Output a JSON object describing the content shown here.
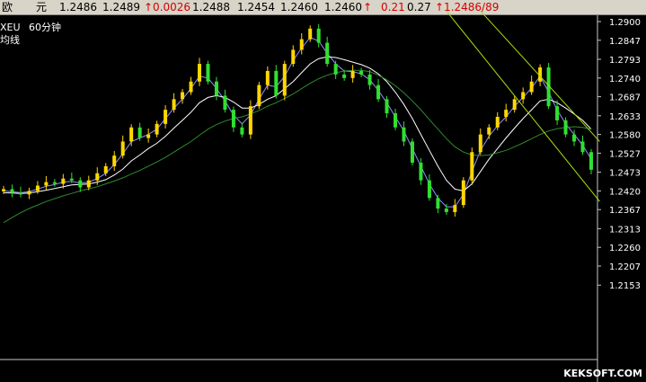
{
  "quote": {
    "name1": "欧",
    "name2": "元",
    "v1": "1.2486",
    "v2": "1.2489",
    "change": "↑0.0026",
    "v3": "1.2488",
    "v4": "1.2454",
    "v5": "1.2460",
    "v6": "1.2460",
    "arrow": "↑",
    "v7": "0.21",
    "v8": "0.27",
    "last": "↑1.2486/89"
  },
  "symbol_label": "XEU",
  "period_label": "60分钟",
  "ma_label": "均线",
  "watermark": "KEKSOFT.COM",
  "colors": {
    "background": "#000000",
    "bull_candle": "#ffd700",
    "bear_candle": "#30e030",
    "ma_short": "#9090ff",
    "ma_mid": "#ffffff",
    "ma_long": "#2e8b2e",
    "trend_line": "#a8e010",
    "axis": "#c8c8c8"
  },
  "chart_data": {
    "type": "candlestick",
    "y_axis": {
      "range": [
        1.208,
        1.293
      ],
      "tick_labels": [
        "1.2900",
        "1.2847",
        "1.2793",
        "1.2740",
        "1.2687",
        "1.2633",
        "1.2580",
        "1.2527",
        "1.2473",
        "1.2420",
        "1.2367",
        "1.2313",
        "1.2260",
        "1.2207",
        "1.2153"
      ],
      "tick_values": [
        1.29,
        1.2847,
        1.2793,
        1.274,
        1.2687,
        1.2633,
        1.258,
        1.2527,
        1.2473,
        1.242,
        1.2367,
        1.2313,
        1.226,
        1.2207,
        1.2153
      ]
    },
    "approximate_close_path": [
      1.2425,
      1.2415,
      1.241,
      1.242,
      1.2435,
      1.2445,
      1.244,
      1.2455,
      1.245,
      1.243,
      1.245,
      1.247,
      1.249,
      1.252,
      1.256,
      1.26,
      1.257,
      1.258,
      1.261,
      1.265,
      1.268,
      1.27,
      1.273,
      1.278,
      1.273,
      1.269,
      1.265,
      1.26,
      1.258,
      1.266,
      1.272,
      1.276,
      1.269,
      1.278,
      1.282,
      1.285,
      1.288,
      1.284,
      1.278,
      1.275,
      1.274,
      1.276,
      1.275,
      1.272,
      1.268,
      1.264,
      1.26,
      1.256,
      1.25,
      1.245,
      1.24,
      1.237,
      1.236,
      1.238,
      1.245,
      1.253,
      1.258,
      1.26,
      1.263,
      1.265,
      1.268,
      1.27,
      1.273,
      1.277,
      1.266,
      1.262,
      1.258,
      1.256,
      1.253,
      1.248
    ],
    "moving_averages": [
      {
        "period": "short",
        "values": [
          1.242,
          1.2418,
          1.2415,
          1.2418,
          1.2425,
          1.2433,
          1.2438,
          1.2445,
          1.2447,
          1.2442,
          1.2445,
          1.2455,
          1.247,
          1.2495,
          1.2525,
          1.256,
          1.257,
          1.258,
          1.2595,
          1.2625,
          1.2655,
          1.268,
          1.271,
          1.2745,
          1.274,
          1.271,
          1.2675,
          1.2635,
          1.261,
          1.2635,
          1.268,
          1.272,
          1.2715,
          1.2745,
          1.279,
          1.2825,
          1.2855,
          1.2845,
          1.281,
          1.278,
          1.276,
          1.2758,
          1.2752,
          1.2735,
          1.2705,
          1.267,
          1.263,
          1.259,
          1.254,
          1.249,
          1.244,
          1.24,
          1.2375,
          1.2375,
          1.241,
          1.2475,
          1.2535,
          1.2575,
          1.2605,
          1.263,
          1.266,
          1.2685,
          1.2712,
          1.2745,
          1.27,
          1.265,
          1.261,
          1.258,
          1.255,
          1.251
        ]
      },
      {
        "period": "mid",
        "values": [
          1.2415,
          1.2414,
          1.2413,
          1.2414,
          1.2418,
          1.2422,
          1.2427,
          1.2432,
          1.2437,
          1.2438,
          1.244,
          1.2445,
          1.2452,
          1.2465,
          1.2482,
          1.2505,
          1.2522,
          1.254,
          1.2555,
          1.2575,
          1.2598,
          1.262,
          1.2643,
          1.267,
          1.2685,
          1.269,
          1.2685,
          1.2672,
          1.2655,
          1.2655,
          1.2665,
          1.268,
          1.269,
          1.271,
          1.273,
          1.2755,
          1.278,
          1.2795,
          1.28,
          1.2798,
          1.2792,
          1.2785,
          1.2778,
          1.2768,
          1.2752,
          1.273,
          1.27,
          1.2665,
          1.2625,
          1.258,
          1.2535,
          1.249,
          1.245,
          1.2425,
          1.242,
          1.244,
          1.2475,
          1.251,
          1.254,
          1.257,
          1.2598,
          1.2625,
          1.265,
          1.2675,
          1.268,
          1.267,
          1.2655,
          1.2638,
          1.262,
          1.2595
        ]
      },
      {
        "period": "long",
        "values": [
          1.233,
          1.2345,
          1.2358,
          1.237,
          1.238,
          1.239,
          1.2398,
          1.2406,
          1.2413,
          1.242,
          1.2426,
          1.2432,
          1.244,
          1.2448,
          1.2457,
          1.2468,
          1.2478,
          1.249,
          1.2502,
          1.2515,
          1.253,
          1.2545,
          1.256,
          1.2578,
          1.2595,
          1.2608,
          1.2618,
          1.2625,
          1.263,
          1.2638,
          1.2648,
          1.266,
          1.267,
          1.2682,
          1.2695,
          1.271,
          1.2725,
          1.2738,
          1.2748,
          1.2755,
          1.276,
          1.2762,
          1.2762,
          1.2758,
          1.2748,
          1.2735,
          1.2718,
          1.2698,
          1.2675,
          1.265,
          1.2622,
          1.2595,
          1.2568,
          1.2545,
          1.253,
          1.2522,
          1.252,
          1.2522,
          1.2528,
          1.2535,
          1.2545,
          1.2556,
          1.2568,
          1.258,
          1.259,
          1.2596,
          1.26,
          1.2602,
          1.26,
          1.2595
        ]
      }
    ],
    "trend_lines": [
      {
        "from": [
          52,
          1.293
        ],
        "to": [
          70,
          1.239
        ]
      },
      {
        "from": [
          56,
          1.293
        ],
        "to": [
          70,
          1.256
        ]
      }
    ],
    "grid": false
  }
}
